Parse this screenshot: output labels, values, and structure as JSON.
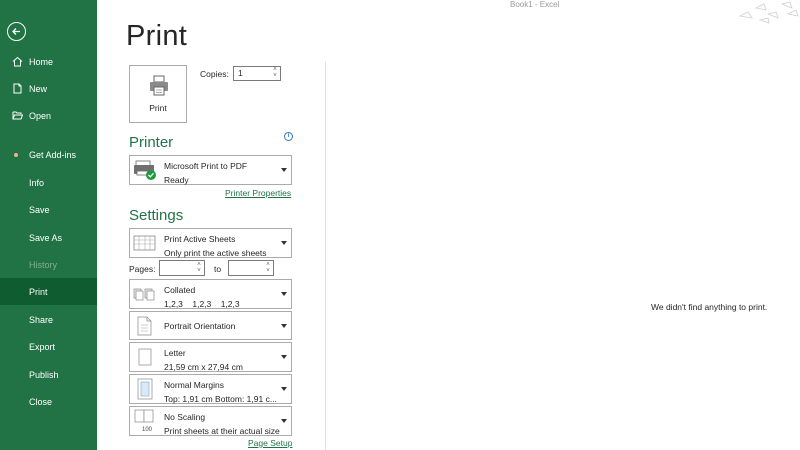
{
  "window": {
    "title": "Book1  -  Excel"
  },
  "sidebar": {
    "items": [
      {
        "label": "Home",
        "icon": "home-icon"
      },
      {
        "label": "New",
        "icon": "new-document-icon"
      },
      {
        "label": "Open",
        "icon": "folder-open-icon"
      },
      {
        "label": "Get Add-ins",
        "icon": "dot-icon"
      },
      {
        "label": "Info"
      },
      {
        "label": "Save"
      },
      {
        "label": "Save As"
      },
      {
        "label": "History",
        "state": "disabled"
      },
      {
        "label": "Print",
        "state": "selected"
      },
      {
        "label": "Share"
      },
      {
        "label": "Export"
      },
      {
        "label": "Publish"
      },
      {
        "label": "Close"
      }
    ],
    "colors": {
      "background": "#217346",
      "selected": "#0e5c2f",
      "addin_dot": "#f4b183"
    }
  },
  "page": {
    "title": "Print"
  },
  "print_button": {
    "label": "Print"
  },
  "copies": {
    "label": "Copies:",
    "value": "1"
  },
  "printer": {
    "section_title": "Printer",
    "name": "Microsoft Print to PDF",
    "status": "Ready",
    "properties_link": "Printer Properties"
  },
  "settings": {
    "section_title": "Settings",
    "what": {
      "line1": "Print Active Sheets",
      "line2": "Only print the active sheets"
    },
    "pages": {
      "label": "Pages:",
      "to_label": "to",
      "from": "",
      "to": ""
    },
    "collation": {
      "line1": "Collated",
      "line2": "1,2,3    1,2,3    1,2,3"
    },
    "orientation": {
      "line1": "Portrait Orientation"
    },
    "paper": {
      "line1": "Letter",
      "line2": "21,59 cm x 27,94 cm"
    },
    "margins": {
      "line1": "Normal Margins",
      "line2": "Top: 1,91 cm Bottom: 1,91 c..."
    },
    "scaling": {
      "line1": "No Scaling",
      "line2": "Print sheets at their actual size"
    },
    "page_setup_link": "Page Setup"
  },
  "preview": {
    "message": "We didn't find anything to print."
  },
  "accent": "#217346"
}
